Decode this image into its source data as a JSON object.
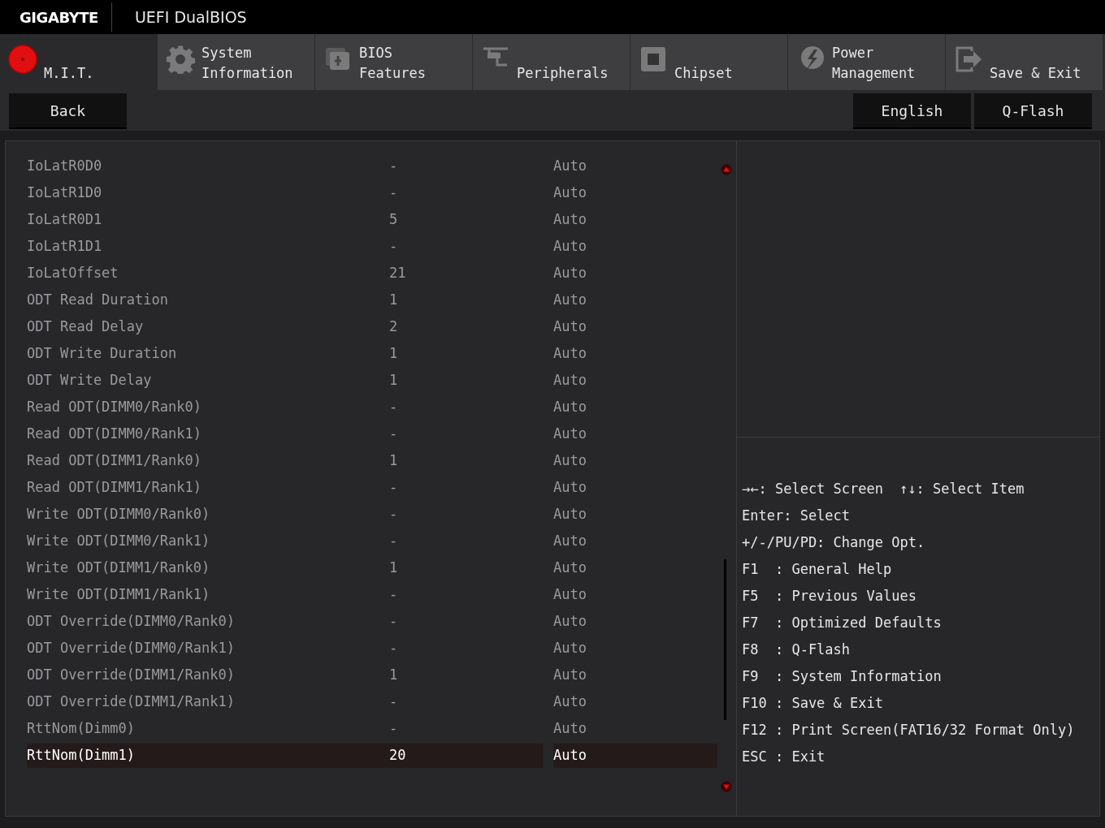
{
  "header": {
    "brand": "GIGABYTE",
    "title": "UEFI DualBIOS"
  },
  "tabs": [
    {
      "lines": [
        "M.I.T."
      ],
      "selected": true
    },
    {
      "lines": [
        "System",
        "Information"
      ],
      "selected": false
    },
    {
      "lines": [
        "BIOS",
        "Features"
      ],
      "selected": false
    },
    {
      "lines": [
        "Peripherals"
      ],
      "selected": false
    },
    {
      "lines": [
        "Chipset"
      ],
      "selected": false
    },
    {
      "lines": [
        "Power",
        "Management"
      ],
      "selected": false
    },
    {
      "lines": [
        "Save & Exit"
      ],
      "selected": false
    }
  ],
  "toolbar": {
    "back": "Back",
    "right_buttons": [
      "English",
      "Q-Flash"
    ]
  },
  "settings": [
    {
      "name": "IoLatR0D0",
      "value": "-",
      "option": "Auto",
      "selected": false
    },
    {
      "name": "IoLatR1D0",
      "value": "-",
      "option": "Auto",
      "selected": false
    },
    {
      "name": "IoLatR0D1",
      "value": "5",
      "option": "Auto",
      "selected": false
    },
    {
      "name": "IoLatR1D1",
      "value": "-",
      "option": "Auto",
      "selected": false
    },
    {
      "name": "IoLatOffset",
      "value": "21",
      "option": "Auto",
      "selected": false
    },
    {
      "name": "ODT Read Duration",
      "value": "1",
      "option": "Auto",
      "selected": false
    },
    {
      "name": "ODT Read Delay",
      "value": "2",
      "option": "Auto",
      "selected": false
    },
    {
      "name": "ODT Write Duration",
      "value": "1",
      "option": "Auto",
      "selected": false
    },
    {
      "name": "ODT Write Delay",
      "value": "1",
      "option": "Auto",
      "selected": false
    },
    {
      "name": "Read ODT(DIMM0/Rank0)",
      "value": "-",
      "option": "Auto",
      "selected": false
    },
    {
      "name": "Read ODT(DIMM0/Rank1)",
      "value": "-",
      "option": "Auto",
      "selected": false
    },
    {
      "name": "Read ODT(DIMM1/Rank0)",
      "value": "1",
      "option": "Auto",
      "selected": false
    },
    {
      "name": "Read ODT(DIMM1/Rank1)",
      "value": "-",
      "option": "Auto",
      "selected": false
    },
    {
      "name": "Write ODT(DIMM0/Rank0)",
      "value": "-",
      "option": "Auto",
      "selected": false
    },
    {
      "name": "Write ODT(DIMM0/Rank1)",
      "value": "-",
      "option": "Auto",
      "selected": false
    },
    {
      "name": "Write ODT(DIMM1/Rank0)",
      "value": "1",
      "option": "Auto",
      "selected": false
    },
    {
      "name": "Write ODT(DIMM1/Rank1)",
      "value": "-",
      "option": "Auto",
      "selected": false
    },
    {
      "name": "ODT Override(DIMM0/Rank0)",
      "value": "-",
      "option": "Auto",
      "selected": false
    },
    {
      "name": "ODT Override(DIMM0/Rank1)",
      "value": "-",
      "option": "Auto",
      "selected": false
    },
    {
      "name": "ODT Override(DIMM1/Rank0)",
      "value": "1",
      "option": "Auto",
      "selected": false
    },
    {
      "name": "ODT Override(DIMM1/Rank1)",
      "value": "-",
      "option": "Auto",
      "selected": false
    },
    {
      "name": "RttNom(Dimm0)",
      "value": "-",
      "option": "Auto",
      "selected": false
    },
    {
      "name": "RttNom(Dimm1)",
      "value": "20",
      "option": "Auto",
      "selected": true
    }
  ],
  "help": {
    "first_line": [
      "→←: Select Screen",
      "↑↓: Select Item"
    ],
    "lines": [
      "Enter: Select",
      "+/-/PU/PD: Change Opt.",
      "F1  : General Help",
      "F5  : Previous Values",
      "F7  : Optimized Defaults",
      "F8  : Q-Flash",
      "F9  : System Information",
      "F10 : Save & Exit",
      "F12 : Print Screen(FAT16/32 Format Only)",
      "ESC : Exit"
    ]
  }
}
